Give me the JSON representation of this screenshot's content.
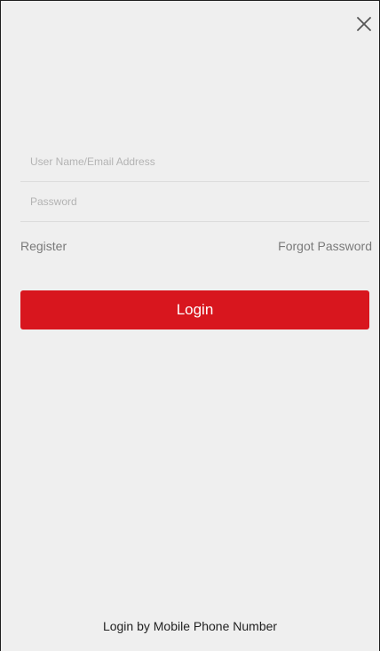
{
  "close": {
    "icon": "close-icon"
  },
  "form": {
    "username_placeholder": "User Name/Email Address",
    "username_value": "",
    "password_placeholder": "Password",
    "password_value": ""
  },
  "links": {
    "register_label": "Register",
    "forgot_password_label": "Forgot Password"
  },
  "login_button": {
    "label": "Login",
    "color": "#d8161e"
  },
  "footer": {
    "phone_login_label": "Login by Mobile Phone Number"
  }
}
